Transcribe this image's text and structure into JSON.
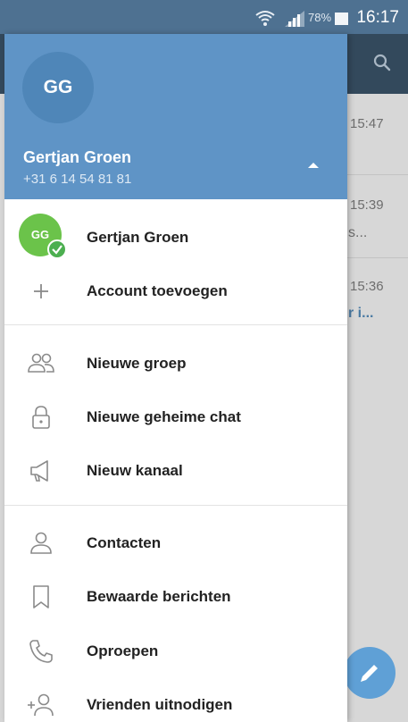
{
  "status_bar": {
    "battery": "78%",
    "time": "16:17"
  },
  "background_chats": [
    {
      "time": "15:47",
      "snippet": ""
    },
    {
      "time": "15:39",
      "snippet": "s..."
    },
    {
      "time": "15:36",
      "snippet": "r i..."
    }
  ],
  "drawer": {
    "avatar_initials": "GG",
    "user_name": "Gertjan Groen",
    "phone": "+31 6 14 54 81 81",
    "accounts": [
      {
        "initials": "GG",
        "name": "Gertjan Groen"
      }
    ],
    "add_account_label": "Account toevoegen",
    "menu_group_1": [
      {
        "icon": "group-icon",
        "label": "Nieuwe groep"
      },
      {
        "icon": "lock-icon",
        "label": "Nieuwe geheime chat"
      },
      {
        "icon": "megaphone-icon",
        "label": "Nieuw kanaal"
      }
    ],
    "menu_group_2": [
      {
        "icon": "person-icon",
        "label": "Contacten"
      },
      {
        "icon": "bookmark-icon",
        "label": "Bewaarde berichten"
      },
      {
        "icon": "phone-icon",
        "label": "Oproepen"
      },
      {
        "icon": "add-person-icon",
        "label": "Vrienden uitnodigen"
      }
    ]
  },
  "colors": {
    "header": "#5f94c6",
    "status_bar": "#4e7191",
    "account_avatar": "#6bc34a"
  }
}
